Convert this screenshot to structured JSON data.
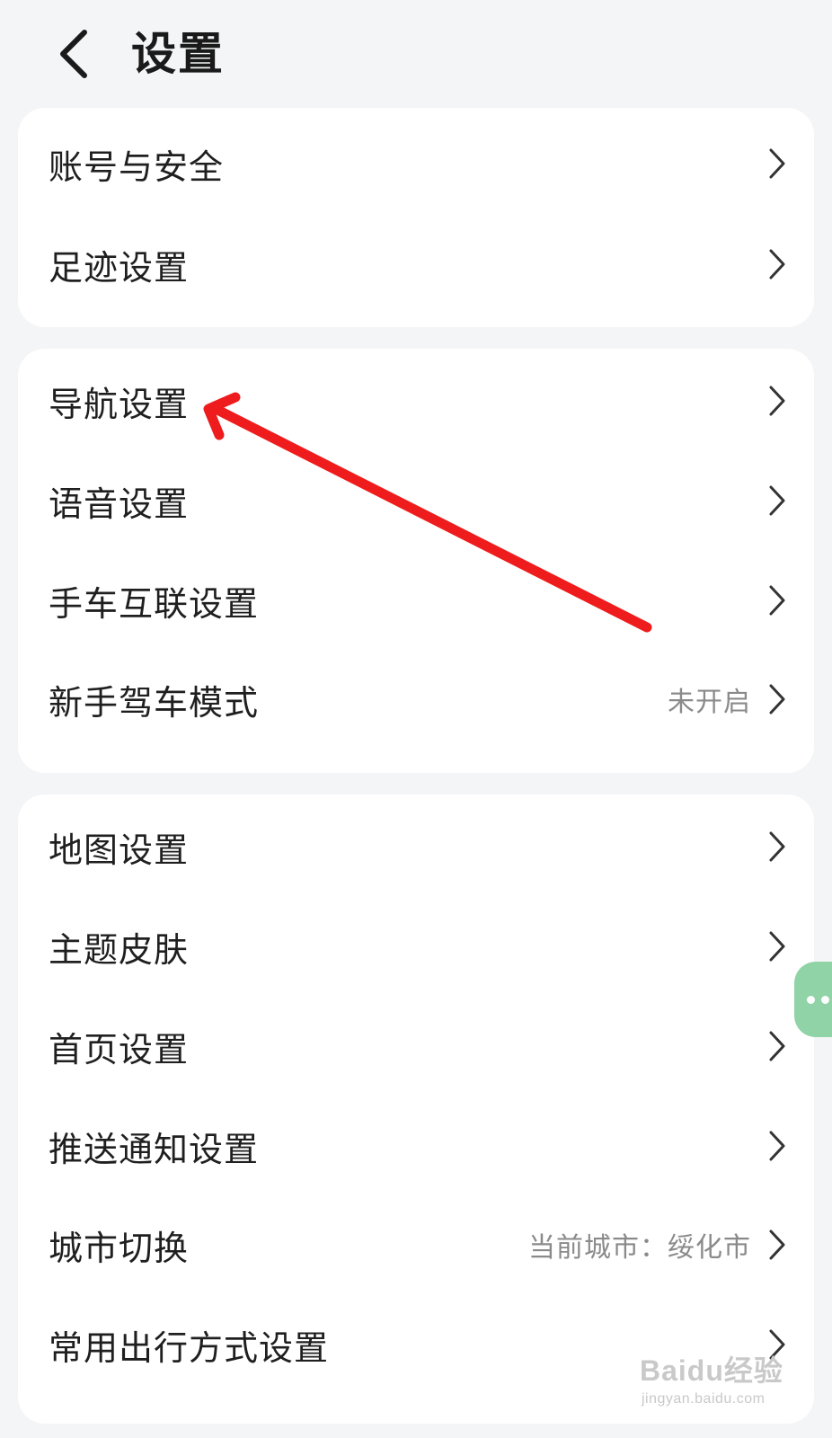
{
  "header": {
    "title": "设置",
    "back_icon": "chevron-left-icon"
  },
  "groups": [
    {
      "items": [
        {
          "label": "账号与安全"
        },
        {
          "label": "足迹设置"
        }
      ]
    },
    {
      "items": [
        {
          "label": "导航设置"
        },
        {
          "label": "语音设置"
        },
        {
          "label": "手车互联设置"
        },
        {
          "label": "新手驾车模式",
          "value": "未开启"
        }
      ]
    },
    {
      "items": [
        {
          "label": "地图设置"
        },
        {
          "label": "主题皮肤"
        },
        {
          "label": "首页设置"
        },
        {
          "label": "推送通知设置"
        },
        {
          "label": "城市切换",
          "value": "当前城市：绥化市"
        },
        {
          "label": "常用出行方式设置"
        }
      ]
    }
  ],
  "annotation": {
    "color": "#ee1c1c",
    "points_to": "导航设置"
  },
  "float_button": {
    "color": "#8fd3a6",
    "icon": "more-dots-icon"
  },
  "watermark": {
    "brand": "Baidu经验",
    "url": "jingyan.baidu.com"
  }
}
